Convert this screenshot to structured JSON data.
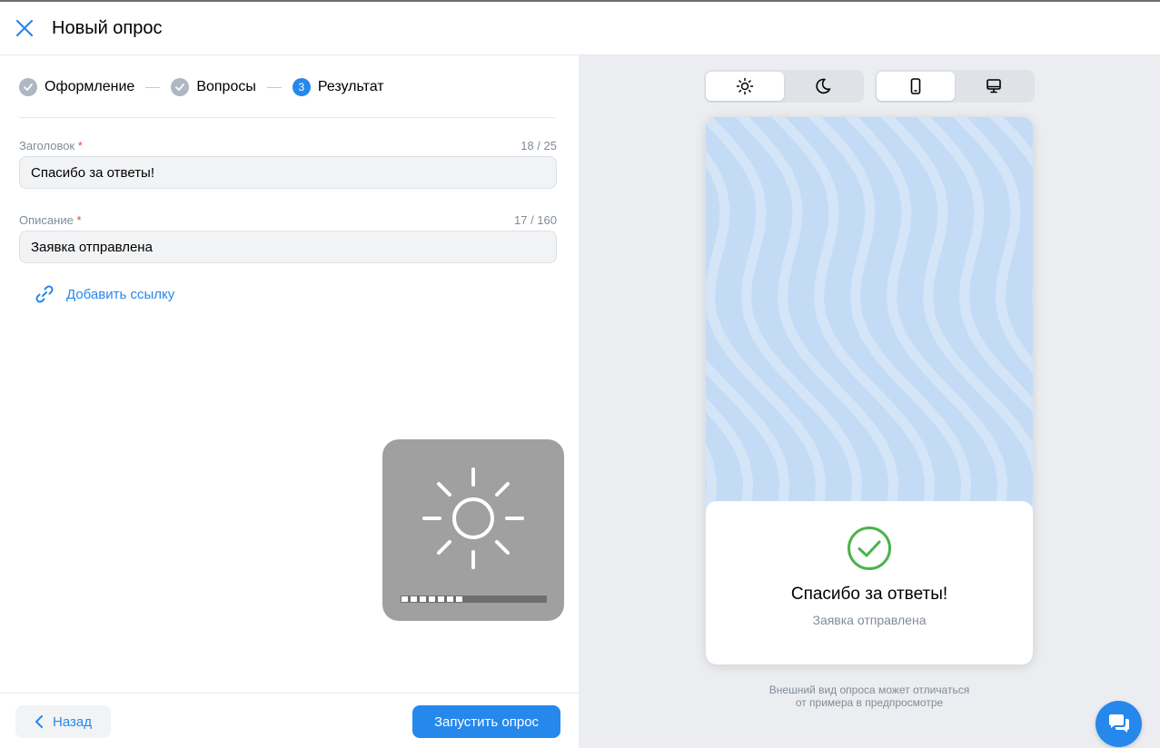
{
  "header": {
    "title": "Новый опрос"
  },
  "stepper": {
    "steps": [
      {
        "label": "Оформление",
        "state": "done"
      },
      {
        "label": "Вопросы",
        "state": "done"
      },
      {
        "label": "Результат",
        "state": "active",
        "number": "3"
      }
    ]
  },
  "form": {
    "title_field": {
      "label": "Заголовок",
      "required_mark": "*",
      "counter": "18 / 25",
      "value": "Спасибо за ответы!"
    },
    "description_field": {
      "label": "Описание",
      "required_mark": "*",
      "counter": "17 / 160",
      "value": "Заявка отправлена"
    },
    "add_link_label": "Добавить ссылку"
  },
  "footer": {
    "back_label": "Назад",
    "launch_label": "Запустить опрос"
  },
  "brightness_hud": {
    "level_fraction": 0.44,
    "segments_filled": 7,
    "segments_total": 16
  },
  "preview": {
    "theme_toggle": {
      "options": [
        "sun-icon",
        "moon-icon"
      ],
      "selected": "sun-icon"
    },
    "device_toggle": {
      "options": [
        "phone-icon",
        "desktop-icon"
      ],
      "selected": "phone-icon"
    },
    "result_title": "Спасибо за ответы!",
    "result_description": "Заявка отправлена",
    "disclaimer_line1": "Внешний вид опроса может отличаться",
    "disclaimer_line2": "от примера в предпросмотре"
  },
  "colors": {
    "accent": "#2688eb",
    "success": "#4bb34b",
    "preview_bg": "#c4dbf5",
    "panel_bg": "#ebedf0",
    "required": "#e64646"
  }
}
